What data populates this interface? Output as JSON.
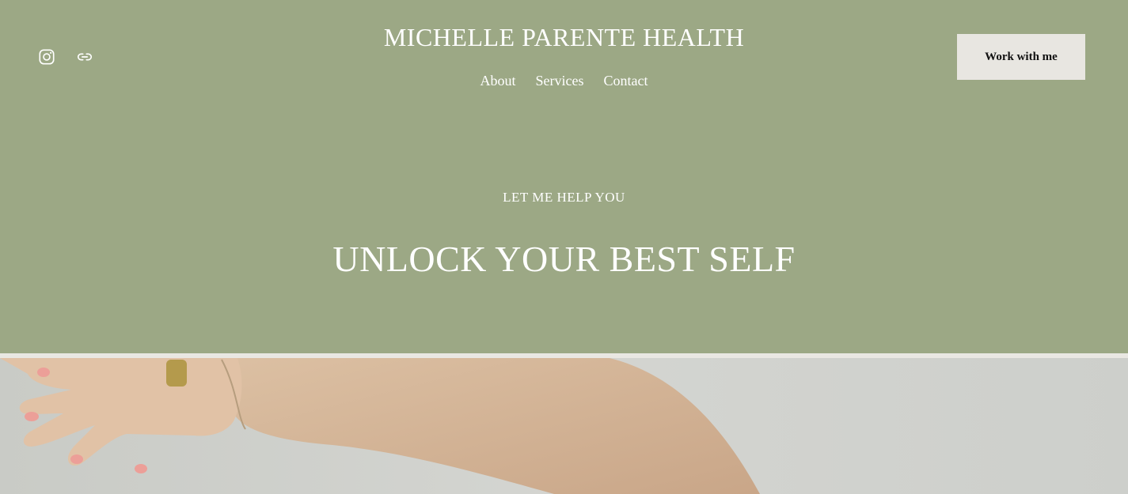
{
  "header": {
    "brand": "MICHELLE PARENTE HEALTH",
    "nav": [
      {
        "label": "About"
      },
      {
        "label": "Services"
      },
      {
        "label": "Contact"
      }
    ],
    "cta_label": "Work with me",
    "social_icons": [
      "instagram-icon",
      "link-icon"
    ]
  },
  "hero": {
    "eyebrow": "LET ME HELP YOU",
    "headline": "UNLOCK YOUR BEST SELF"
  },
  "colors": {
    "background": "#9ca885",
    "cta_background": "#e8e6e1",
    "text": "#ffffff"
  }
}
